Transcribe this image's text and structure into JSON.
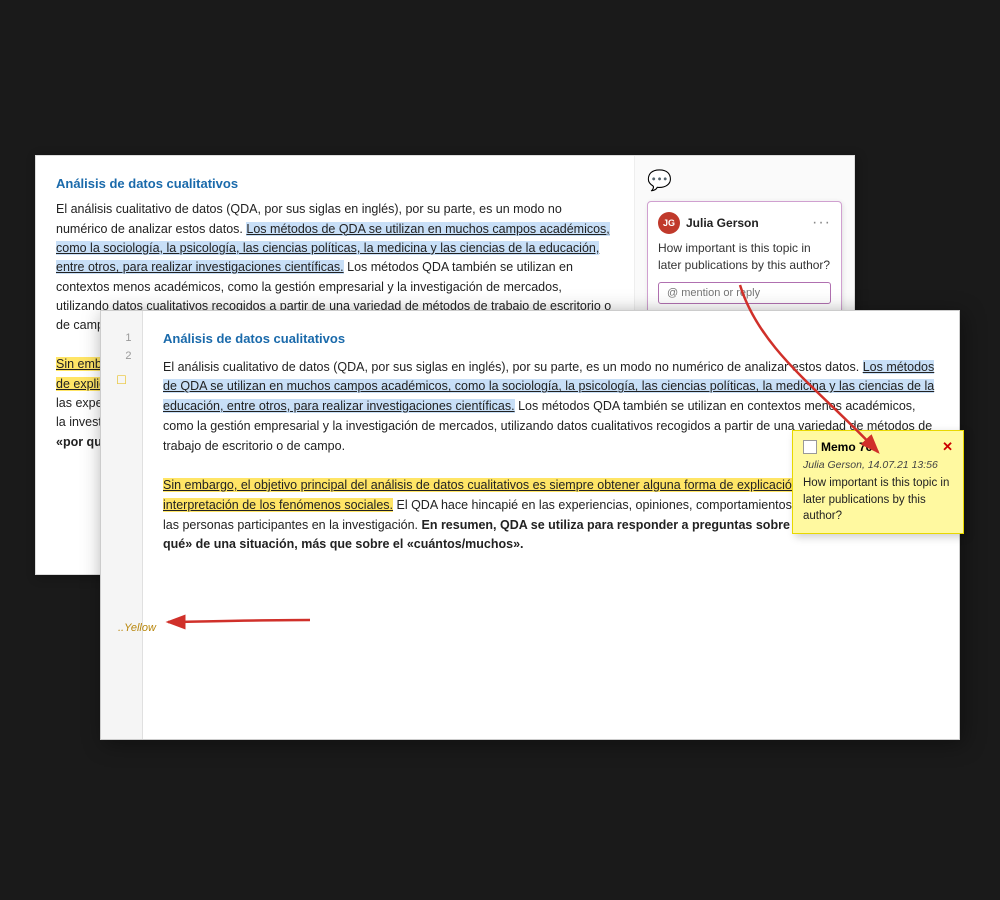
{
  "back_doc": {
    "title": "Análisis de datos cualitativos",
    "paragraph1": "El análisis cualitativo de datos (QDA, por sus siglas en inglés), por su parte, es un modo no numérico de analizar estos datos.",
    "highlight1": "Los métodos de QDA se utilizan en muchos campos académicos, como la sociología, la psicología, las ciencias políticas, la medicina y las ciencias de la educación, entre otros, para realizar investigaciones científicas.",
    "paragraph1b": " Los métodos QDA también se utilizan en contextos menos académicos, como la gestión empresarial y la investigación de mercados, utilizando datos cualitativos recogidos a partir de una variedad de métodos de trabajo de escritorio o de campo.",
    "highlight2": "Sin embargo, el objetivo principal del análisis de datos cualitativos es siempre obtener alguna forma de explicación, comprensión o interpretación de los fenómenos sociales.",
    "paragraph2b": " El QDA hace hincapié en las experiencias, opiniones, comportamientos y contextos sociales de las personas participantes en la investigación.",
    "paragraph2c": " En resumen, QDA se utiliza para responder a preguntas sobre el «cómo» y el «por qué» de una situación, más que sobre el «cuántos/muchos».",
    "comment": {
      "avatar": "JG",
      "author": "Julia Gerson",
      "menu": "···",
      "text": "How important is this topic in later publications by this author?",
      "input_placeholder": "@ mention or reply"
    }
  },
  "front_doc": {
    "title": "Análisis de datos cualitativos",
    "line_numbers": [
      "1",
      "2"
    ],
    "paragraph1": "El análisis cualitativo de datos (QDA, por sus siglas en inglés), por su parte, es un modo no numérico de analizar estos datos.",
    "highlight1": "Los métodos de QDA se utilizan en muchos campos académicos, como la sociología, la psicología, las ciencias políticas, la medicina y las ciencias de la educación, entre otros, para realizar investigaciones científicas.",
    "paragraph1b": " Los métodos QDA también se utilizan en contextos menos académicos, como la gestión empresarial y la investigación de mercados, utilizando datos cualitativos recogidos a partir de una variedad de métodos de trabajo de escritorio o de campo.",
    "highlight2": "Sin embargo, el objetivo principal del análisis de datos cualitativos es siempre obtener alguna forma de explicación, comprensión o interpretación de los fenómenos sociales.",
    "paragraph2b": " El QDA hace hincapié en las experiencias, opiniones, comportamientos y contextos sociales de las personas participantes en la investigación.",
    "paragraph2c_bold": " En resumen, QDA se utiliza para responder a preguntas sobre el «cómo» y el «por qué» de una situación, más que sobre el «cuántos/muchos».",
    "yellow_label": "..Yellow"
  },
  "memo": {
    "icon": "□",
    "title": "Memo 76",
    "close": "✕",
    "meta": "Julia Gerson, 14.07.21 13:56",
    "body": "How important is this topic in later publications by this author?"
  },
  "mention_reply_label": "mention reply"
}
